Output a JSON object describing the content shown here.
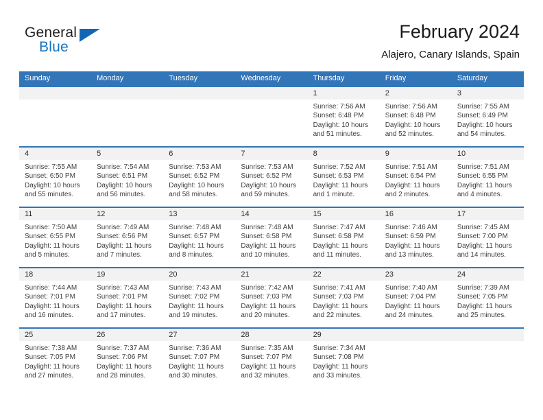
{
  "brand": {
    "line1": "General",
    "line2": "Blue",
    "triangle_icon": "triangle-icon"
  },
  "header": {
    "title": "February 2024",
    "subtitle": "Alajero, Canary Islands, Spain"
  },
  "colors": {
    "header_blue": "#3275b8",
    "brand_blue": "#1273c4",
    "day_band_gray": "#f2f2f2",
    "text": "#3d3d3d"
  },
  "weekdays": [
    "Sunday",
    "Monday",
    "Tuesday",
    "Wednesday",
    "Thursday",
    "Friday",
    "Saturday"
  ],
  "labels": {
    "sunrise": "Sunrise:",
    "sunset": "Sunset:",
    "daylight": "Daylight:"
  },
  "weeks": [
    [
      {
        "day": "",
        "sunrise": "",
        "sunset": "",
        "daylight": ""
      },
      {
        "day": "",
        "sunrise": "",
        "sunset": "",
        "daylight": ""
      },
      {
        "day": "",
        "sunrise": "",
        "sunset": "",
        "daylight": ""
      },
      {
        "day": "",
        "sunrise": "",
        "sunset": "",
        "daylight": ""
      },
      {
        "day": "1",
        "sunrise": "Sunrise: 7:56 AM",
        "sunset": "Sunset: 6:48 PM",
        "daylight": "Daylight: 10 hours and 51 minutes."
      },
      {
        "day": "2",
        "sunrise": "Sunrise: 7:56 AM",
        "sunset": "Sunset: 6:48 PM",
        "daylight": "Daylight: 10 hours and 52 minutes."
      },
      {
        "day": "3",
        "sunrise": "Sunrise: 7:55 AM",
        "sunset": "Sunset: 6:49 PM",
        "daylight": "Daylight: 10 hours and 54 minutes."
      }
    ],
    [
      {
        "day": "4",
        "sunrise": "Sunrise: 7:55 AM",
        "sunset": "Sunset: 6:50 PM",
        "daylight": "Daylight: 10 hours and 55 minutes."
      },
      {
        "day": "5",
        "sunrise": "Sunrise: 7:54 AM",
        "sunset": "Sunset: 6:51 PM",
        "daylight": "Daylight: 10 hours and 56 minutes."
      },
      {
        "day": "6",
        "sunrise": "Sunrise: 7:53 AM",
        "sunset": "Sunset: 6:52 PM",
        "daylight": "Daylight: 10 hours and 58 minutes."
      },
      {
        "day": "7",
        "sunrise": "Sunrise: 7:53 AM",
        "sunset": "Sunset: 6:52 PM",
        "daylight": "Daylight: 10 hours and 59 minutes."
      },
      {
        "day": "8",
        "sunrise": "Sunrise: 7:52 AM",
        "sunset": "Sunset: 6:53 PM",
        "daylight": "Daylight: 11 hours and 1 minute."
      },
      {
        "day": "9",
        "sunrise": "Sunrise: 7:51 AM",
        "sunset": "Sunset: 6:54 PM",
        "daylight": "Daylight: 11 hours and 2 minutes."
      },
      {
        "day": "10",
        "sunrise": "Sunrise: 7:51 AM",
        "sunset": "Sunset: 6:55 PM",
        "daylight": "Daylight: 11 hours and 4 minutes."
      }
    ],
    [
      {
        "day": "11",
        "sunrise": "Sunrise: 7:50 AM",
        "sunset": "Sunset: 6:55 PM",
        "daylight": "Daylight: 11 hours and 5 minutes."
      },
      {
        "day": "12",
        "sunrise": "Sunrise: 7:49 AM",
        "sunset": "Sunset: 6:56 PM",
        "daylight": "Daylight: 11 hours and 7 minutes."
      },
      {
        "day": "13",
        "sunrise": "Sunrise: 7:48 AM",
        "sunset": "Sunset: 6:57 PM",
        "daylight": "Daylight: 11 hours and 8 minutes."
      },
      {
        "day": "14",
        "sunrise": "Sunrise: 7:48 AM",
        "sunset": "Sunset: 6:58 PM",
        "daylight": "Daylight: 11 hours and 10 minutes."
      },
      {
        "day": "15",
        "sunrise": "Sunrise: 7:47 AM",
        "sunset": "Sunset: 6:58 PM",
        "daylight": "Daylight: 11 hours and 11 minutes."
      },
      {
        "day": "16",
        "sunrise": "Sunrise: 7:46 AM",
        "sunset": "Sunset: 6:59 PM",
        "daylight": "Daylight: 11 hours and 13 minutes."
      },
      {
        "day": "17",
        "sunrise": "Sunrise: 7:45 AM",
        "sunset": "Sunset: 7:00 PM",
        "daylight": "Daylight: 11 hours and 14 minutes."
      }
    ],
    [
      {
        "day": "18",
        "sunrise": "Sunrise: 7:44 AM",
        "sunset": "Sunset: 7:01 PM",
        "daylight": "Daylight: 11 hours and 16 minutes."
      },
      {
        "day": "19",
        "sunrise": "Sunrise: 7:43 AM",
        "sunset": "Sunset: 7:01 PM",
        "daylight": "Daylight: 11 hours and 17 minutes."
      },
      {
        "day": "20",
        "sunrise": "Sunrise: 7:43 AM",
        "sunset": "Sunset: 7:02 PM",
        "daylight": "Daylight: 11 hours and 19 minutes."
      },
      {
        "day": "21",
        "sunrise": "Sunrise: 7:42 AM",
        "sunset": "Sunset: 7:03 PM",
        "daylight": "Daylight: 11 hours and 20 minutes."
      },
      {
        "day": "22",
        "sunrise": "Sunrise: 7:41 AM",
        "sunset": "Sunset: 7:03 PM",
        "daylight": "Daylight: 11 hours and 22 minutes."
      },
      {
        "day": "23",
        "sunrise": "Sunrise: 7:40 AM",
        "sunset": "Sunset: 7:04 PM",
        "daylight": "Daylight: 11 hours and 24 minutes."
      },
      {
        "day": "24",
        "sunrise": "Sunrise: 7:39 AM",
        "sunset": "Sunset: 7:05 PM",
        "daylight": "Daylight: 11 hours and 25 minutes."
      }
    ],
    [
      {
        "day": "25",
        "sunrise": "Sunrise: 7:38 AM",
        "sunset": "Sunset: 7:05 PM",
        "daylight": "Daylight: 11 hours and 27 minutes."
      },
      {
        "day": "26",
        "sunrise": "Sunrise: 7:37 AM",
        "sunset": "Sunset: 7:06 PM",
        "daylight": "Daylight: 11 hours and 28 minutes."
      },
      {
        "day": "27",
        "sunrise": "Sunrise: 7:36 AM",
        "sunset": "Sunset: 7:07 PM",
        "daylight": "Daylight: 11 hours and 30 minutes."
      },
      {
        "day": "28",
        "sunrise": "Sunrise: 7:35 AM",
        "sunset": "Sunset: 7:07 PM",
        "daylight": "Daylight: 11 hours and 32 minutes."
      },
      {
        "day": "29",
        "sunrise": "Sunrise: 7:34 AM",
        "sunset": "Sunset: 7:08 PM",
        "daylight": "Daylight: 11 hours and 33 minutes."
      },
      {
        "day": "",
        "sunrise": "",
        "sunset": "",
        "daylight": ""
      },
      {
        "day": "",
        "sunrise": "",
        "sunset": "",
        "daylight": ""
      }
    ]
  ]
}
